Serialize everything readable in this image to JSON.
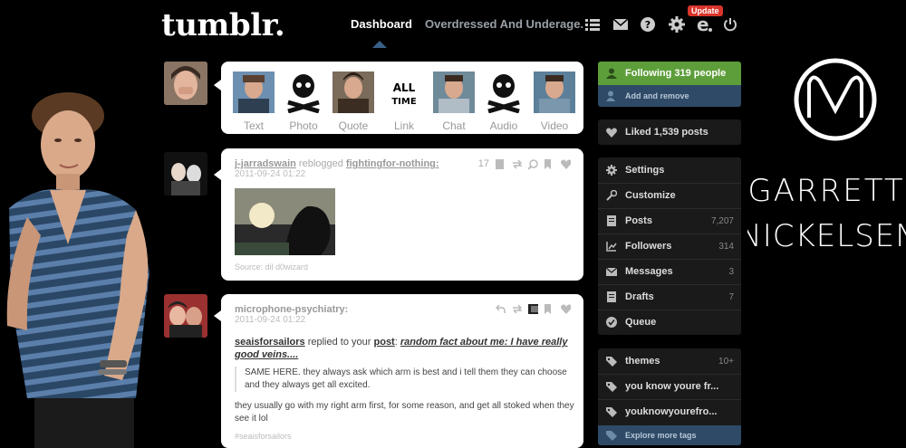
{
  "header": {
    "logo": "tumblr.",
    "nav_dashboard": "Dashboard",
    "nav_blog": "Overdressed And Underage.",
    "update_badge": "Update",
    "icons": [
      "list-icon",
      "mail-icon",
      "help-icon",
      "gear-icon",
      "edit-icon",
      "power-icon"
    ]
  },
  "post_types": [
    {
      "label": "Text"
    },
    {
      "label": "Photo"
    },
    {
      "label": "Quote"
    },
    {
      "label": "Link"
    },
    {
      "label": "Chat"
    },
    {
      "label": "Audio"
    },
    {
      "label": "Video"
    }
  ],
  "post1": {
    "user": "j-jarradswain",
    "action": "reblogged",
    "source_user": "fightingfor-nothing:",
    "date": "2011-09-24 01:22",
    "notes": "17",
    "source": "Source: dil d0wizard"
  },
  "post2": {
    "user": "microphone-psychiatry:",
    "date": "2011-09-24 01:22",
    "replier": "seaisforsailors",
    "replied_text": "replied to your",
    "post_word": "post",
    "post_title": "random fact about me: I have really good veins....",
    "quote": "SAME HERE. they always ask which arm is best and i tell them they can choose and they always get all excited.",
    "body": "they usually go with my right arm first, for some reason, and get all stoked when they see it lol",
    "tag": "#seaisforsailors"
  },
  "sidebar": {
    "following": "Following 319 people",
    "add_remove": "Add and remove",
    "liked": "Liked 1,539 posts",
    "items": [
      {
        "label": "Settings",
        "count": ""
      },
      {
        "label": "Customize",
        "count": ""
      },
      {
        "label": "Posts",
        "count": "7,207"
      },
      {
        "label": "Followers",
        "count": "314"
      },
      {
        "label": "Messages",
        "count": "3"
      },
      {
        "label": "Drafts",
        "count": "7"
      },
      {
        "label": "Queue",
        "count": ""
      }
    ],
    "tags": [
      {
        "label": "themes",
        "count": "10+"
      },
      {
        "label": "you know youre fr...",
        "count": ""
      },
      {
        "label": "youknowyourefro...",
        "count": ""
      }
    ],
    "explore": "Explore more tags"
  },
  "banner": {
    "name_line1": "GARRETT",
    "name_line2": "NICKELSEN"
  },
  "colors": {
    "following_green": "#5d9e3a",
    "add_remove_blue": "#2e4a66",
    "sidebar_bg": "#1a1a1a"
  }
}
